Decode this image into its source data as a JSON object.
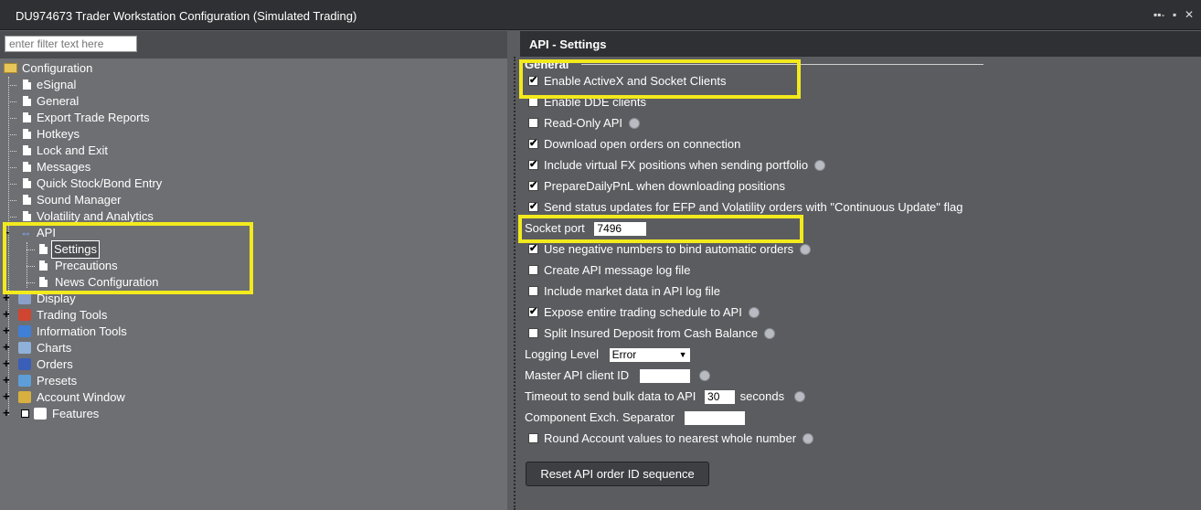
{
  "window": {
    "title": "DU974673 Trader Workstation Configuration (Simulated Trading)",
    "controls": "▪▪- ▪ ✕"
  },
  "filter": {
    "placeholder": "enter filter text here"
  },
  "tree": {
    "root": "Configuration",
    "items": [
      "eSignal",
      "General",
      "Export Trade Reports",
      "Hotkeys",
      "Lock and Exit",
      "Messages",
      "Quick Stock/Bond Entry",
      "Sound Manager",
      "Volatility and Analytics"
    ],
    "api": {
      "label": "API",
      "children": [
        "Settings",
        "Precautions",
        "News Configuration"
      ]
    },
    "categories": [
      "Display",
      "Trading Tools",
      "Information Tools",
      "Charts",
      "Orders",
      "Presets",
      "Account Window",
      "Features"
    ]
  },
  "panel": {
    "header": "API - Settings",
    "section": "General",
    "options": [
      {
        "label": "Enable ActiveX and Socket Clients",
        "checked": true,
        "help": false
      },
      {
        "label": "Enable DDE clients",
        "checked": false,
        "help": false
      },
      {
        "label": "Read-Only API",
        "checked": false,
        "help": true
      },
      {
        "label": "Download open orders on connection",
        "checked": true,
        "help": false
      },
      {
        "label": "Include virtual FX positions when sending portfolio",
        "checked": true,
        "help": true
      },
      {
        "label": "PrepareDailyPnL when downloading positions",
        "checked": true,
        "help": false
      },
      {
        "label": "Send status updates for EFP and Volatility orders with \"Continuous Update\" flag",
        "checked": true,
        "help": false
      }
    ],
    "socket_port": {
      "label": "Socket port",
      "value": "7496"
    },
    "options2": [
      {
        "label": "Use negative numbers to bind automatic orders",
        "checked": true,
        "help": true
      },
      {
        "label": "Create API message log file",
        "checked": false,
        "help": false
      },
      {
        "label": "Include market data in API log file",
        "checked": false,
        "help": false
      },
      {
        "label": "Expose entire trading schedule to API",
        "checked": true,
        "help": true
      },
      {
        "label": "Split Insured Deposit from Cash Balance",
        "checked": false,
        "help": true
      }
    ],
    "logging_level": {
      "label": "Logging Level",
      "value": "Error"
    },
    "master_client": {
      "label": "Master API client ID",
      "value": ""
    },
    "timeout": {
      "label": "Timeout to send bulk data to API",
      "value": "30",
      "unit": "seconds"
    },
    "separator": {
      "label": "Component Exch. Separator",
      "value": ""
    },
    "round": {
      "label": "Round Account values to nearest whole number",
      "checked": false
    },
    "reset_button": "Reset API order ID sequence"
  }
}
